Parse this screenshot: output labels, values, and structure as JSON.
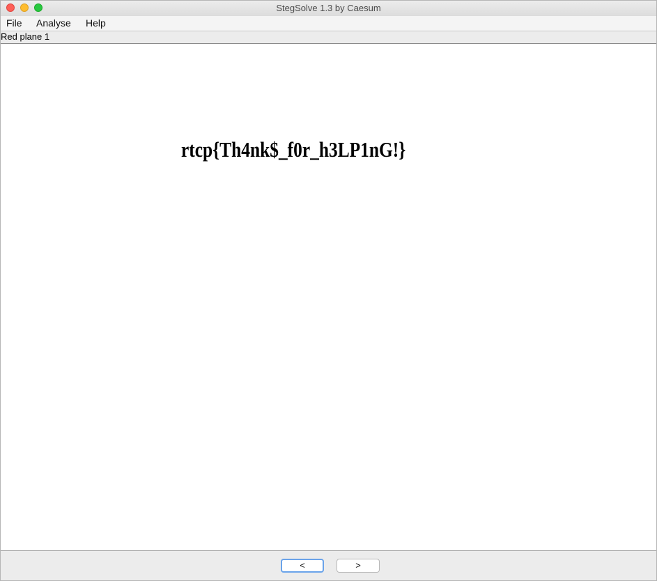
{
  "window": {
    "title": "StegSolve 1.3 by Caesum"
  },
  "menu": {
    "items": [
      {
        "label": "File"
      },
      {
        "label": "Analyse"
      },
      {
        "label": "Help"
      }
    ]
  },
  "view": {
    "plane_label": "Red plane 1",
    "image_text": "rtcp{Th4nk$_f0r_h3LP1nG!}"
  },
  "nav": {
    "prev_label": "<",
    "next_label": ">"
  },
  "colors": {
    "close": "#fe5f57",
    "minimize": "#febc2e",
    "maximize": "#28c840",
    "focus_ring": "#6aa3ea"
  }
}
